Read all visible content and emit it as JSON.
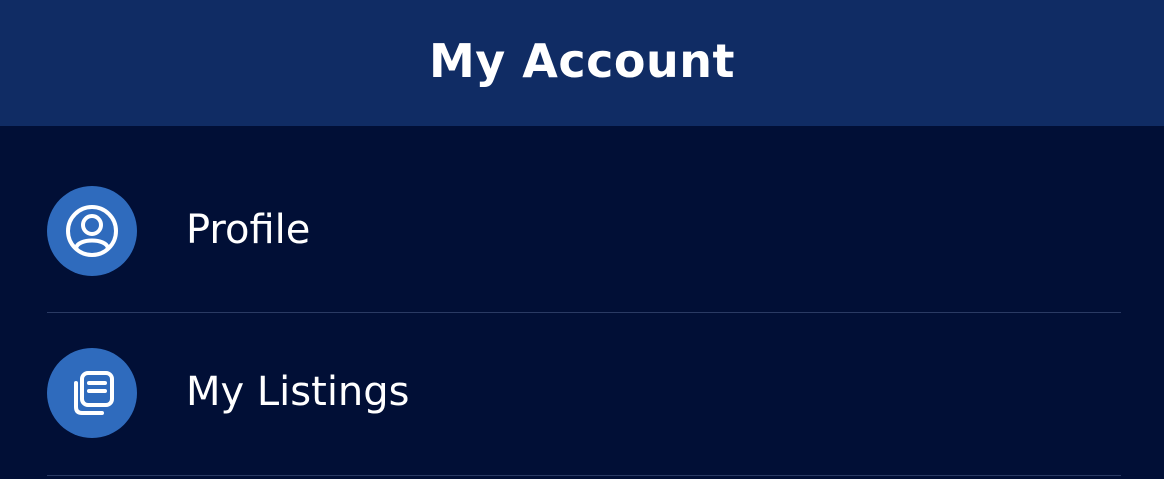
{
  "header": {
    "title": "My Account"
  },
  "menu": {
    "items": [
      {
        "label": "Profile",
        "icon": "user-circle-icon"
      },
      {
        "label": "My Listings",
        "icon": "listings-icon"
      }
    ]
  },
  "colors": {
    "header_bg": "#102c64",
    "page_bg": "#010f36",
    "icon_bg": "#2f6bbd",
    "divider": "#2a3a63",
    "text": "#ffffff"
  }
}
